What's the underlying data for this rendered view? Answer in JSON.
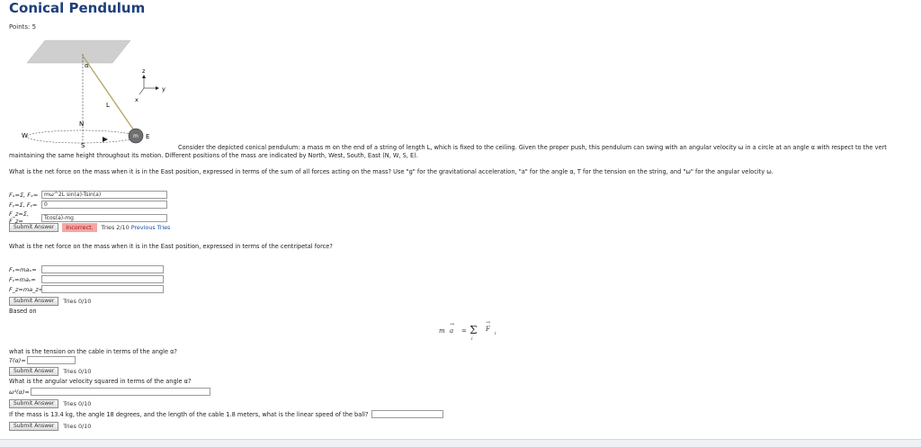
{
  "title": "Conical Pendulum",
  "points": "Points: 5",
  "diagram": {
    "alpha": "α",
    "L": "L",
    "m": "m",
    "N": "N",
    "S": "S",
    "W": "W",
    "E": "E",
    "z": "z",
    "y": "y",
    "x": "x"
  },
  "intro": "Consider the depicted conical pendulum: a mass m on the end of a string of length L, which is fixed to the ceiling. Given the proper push, this pendulum can swing with an angular velocity ω in a circle at an angle α with respect to the vert",
  "intro2": "maintaining the same height throughout its motion. Different positions of the mass are indicated by North, West, South, East (N, W, S, E).",
  "q1": {
    "text": "What is the net force on the mass when it is in the East position, expressed in terms of the sum of all forces acting on the mass? Use \"g\" for the gravitational acceleration, \"a\" for the angle α, T for the tension on the string, and \"ω\" for the angular velocity ω.",
    "rows": [
      {
        "label": "Fₓ=Σ, Fₓ=",
        "value": "mω^2L sin(a)-Tsin(a)"
      },
      {
        "label": "Fᵧ=Σ, Fᵧ=",
        "value": "0"
      },
      {
        "label": "F_z=Σ, F_z=",
        "value": "Tcos(a)-mg"
      }
    ],
    "submit": "Submit Answer",
    "status": "Incorrect.",
    "tries": "Tries 2/10",
    "previous": "Previous Tries"
  },
  "q2": {
    "text": "What is the net force on the mass when it is in the East position, expressed in terms of the centripetal force?",
    "rows": [
      {
        "label": "Fₓ=maₓ=",
        "value": ""
      },
      {
        "label": "Fᵧ=maᵧ=",
        "value": ""
      },
      {
        "label": "F_z=ma_z=",
        "value": ""
      }
    ],
    "submit": "Submit Answer",
    "tries": "Tries 0/10"
  },
  "based_on": "Based on",
  "equation": {
    "m": "m",
    "a": "a",
    "eq": "=",
    "sum": "Σ",
    "F": "F",
    "i": "i"
  },
  "q3": {
    "text": "what is the tension on the cable in terms of the angle α?",
    "label": "T(α)=",
    "value": "",
    "submit": "Submit Answer",
    "tries": "Tries 0/10"
  },
  "q4": {
    "text": "What is the angular velocity squared in terms of the angle α?",
    "label": "ω²(α)=",
    "value": "",
    "submit": "Submit Answer",
    "tries": "Tries 0/10"
  },
  "q5": {
    "text": "If the mass is 13.4 kg, the angle 18 degrees, and the length of the cable 1.8 meters, what is the linear speed of the ball?",
    "value": "",
    "submit": "Submit Answer",
    "tries": "Tries 0/10"
  }
}
